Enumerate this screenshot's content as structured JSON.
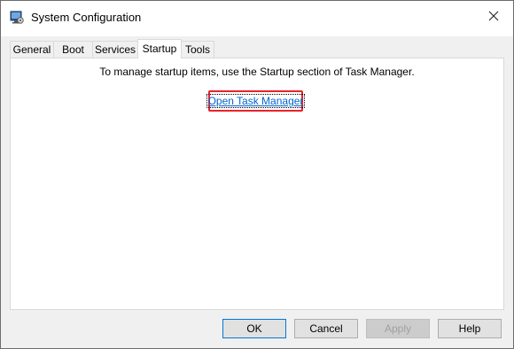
{
  "window": {
    "title": "System Configuration",
    "icon": "system-config-icon",
    "close_icon": "close-icon"
  },
  "tabs": [
    {
      "label": "General",
      "active": false
    },
    {
      "label": "Boot",
      "active": false
    },
    {
      "label": "Services",
      "active": false
    },
    {
      "label": "Startup",
      "active": true
    },
    {
      "label": "Tools",
      "active": false
    }
  ],
  "startup": {
    "info": "To manage startup items, use the Startup section of Task Manager.",
    "link_label": "Open Task Manager",
    "highlight_color": "#e8232a",
    "link_color": "#0066cc"
  },
  "buttons": {
    "ok": "OK",
    "cancel": "Cancel",
    "apply": "Apply",
    "help": "Help"
  }
}
